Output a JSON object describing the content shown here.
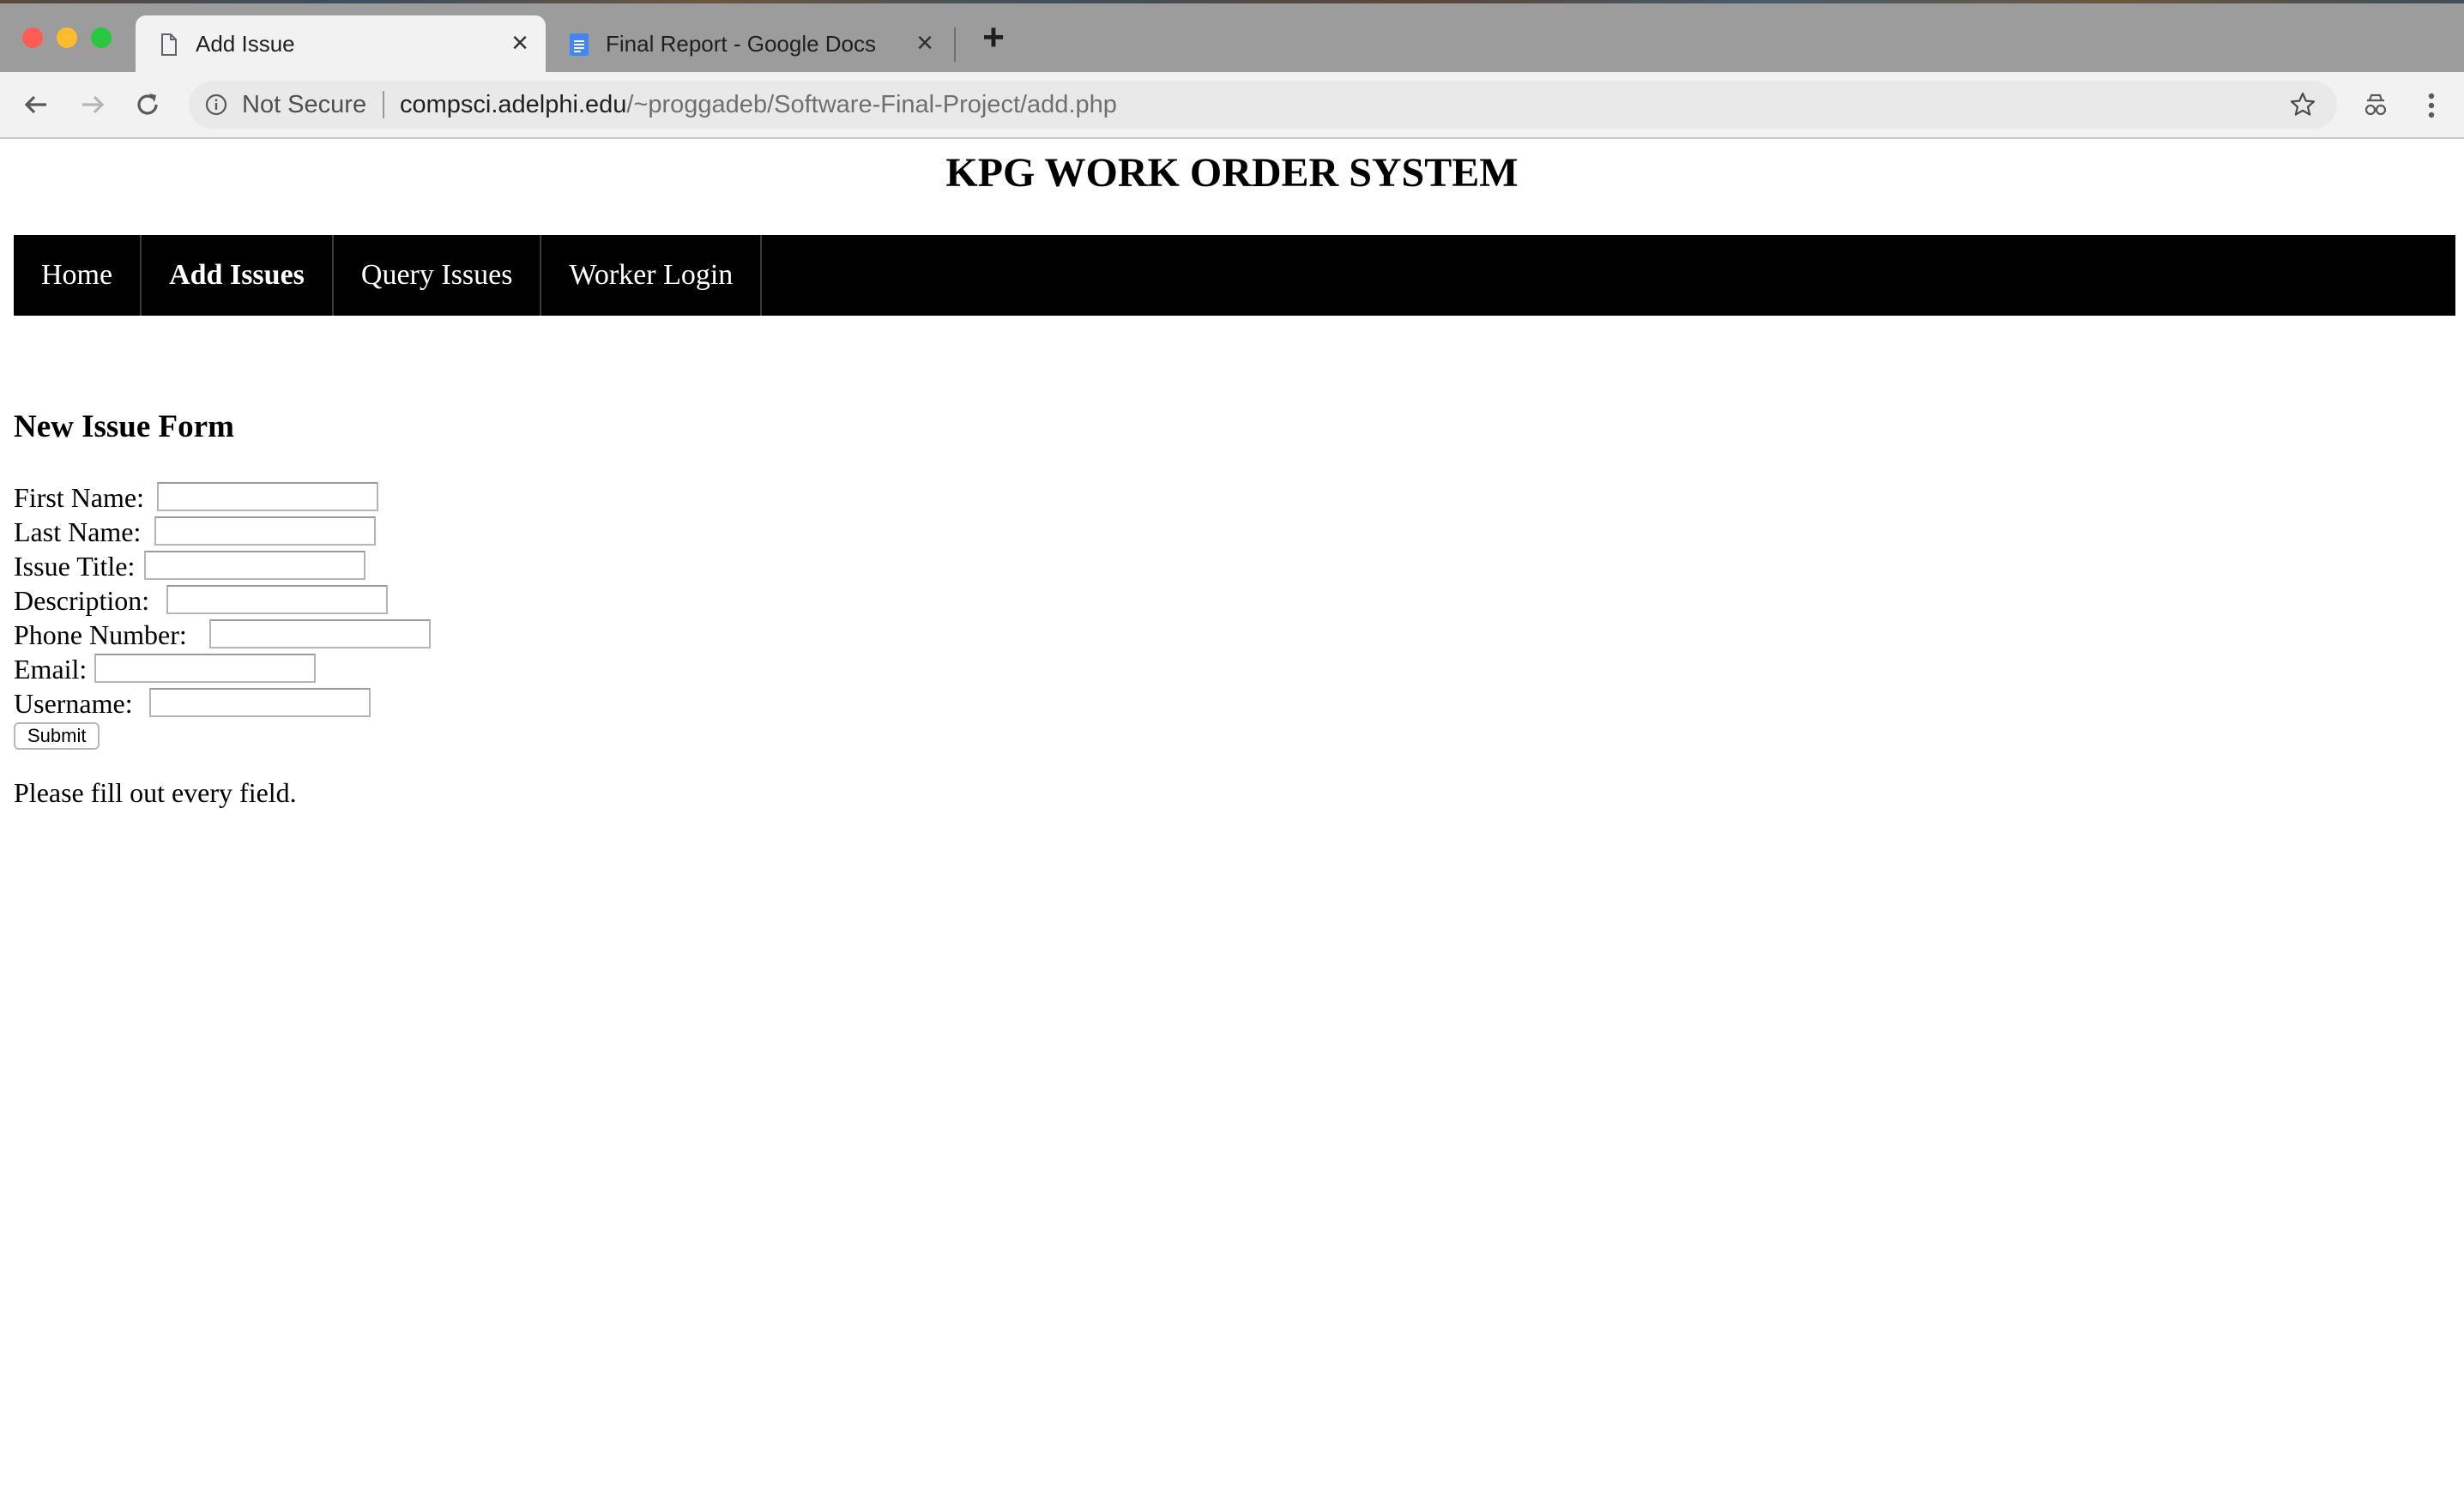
{
  "browser": {
    "tabs": [
      {
        "title": "Add Issue",
        "icon": "document-icon",
        "active": true
      },
      {
        "title": "Final Report - Google Docs",
        "icon": "google-docs-icon",
        "active": false
      }
    ],
    "security_label": "Not Secure",
    "url_host": "compsci.adelphi.edu",
    "url_path": "/~proggadeb/Software-Final-Project/add.php"
  },
  "site": {
    "title": "KPG WORK ORDER SYSTEM",
    "nav": [
      {
        "label": "Home",
        "active": false
      },
      {
        "label": "Add Issues",
        "active": true
      },
      {
        "label": "Query Issues",
        "active": false
      },
      {
        "label": "Worker Login",
        "active": false
      }
    ]
  },
  "form": {
    "heading": "New Issue Form",
    "fields": [
      {
        "label": "First Name:",
        "value": ""
      },
      {
        "label": "Last Name:",
        "value": ""
      },
      {
        "label": "Issue Title:",
        "value": ""
      },
      {
        "label": "Description:",
        "value": ""
      },
      {
        "label": "Phone Number:",
        "value": ""
      },
      {
        "label": "Email:",
        "value": ""
      },
      {
        "label": "Username:",
        "value": ""
      }
    ],
    "submit_label": "Submit",
    "notice": "Please fill out every field."
  }
}
